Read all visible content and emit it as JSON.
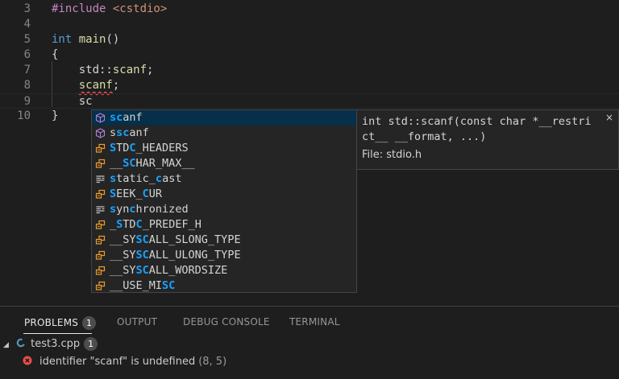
{
  "editor": {
    "lines": [
      {
        "num": "3",
        "segments": [
          {
            "text": "#include ",
            "cls": "tok-inc"
          },
          {
            "text": "<cstdio>",
            "cls": "tok-str"
          }
        ]
      },
      {
        "num": "4",
        "segments": []
      },
      {
        "num": "5",
        "segments": [
          {
            "text": "int",
            "cls": "tok-kw"
          },
          {
            "text": " ",
            "cls": "tok-plain"
          },
          {
            "text": "main",
            "cls": "tok-fn"
          },
          {
            "text": "()",
            "cls": "tok-plain"
          }
        ]
      },
      {
        "num": "6",
        "segments": [
          {
            "text": "{",
            "cls": "tok-plain"
          }
        ]
      },
      {
        "num": "7",
        "segments": [
          {
            "text": "    std::",
            "cls": "tok-plain"
          },
          {
            "text": "scanf",
            "cls": "tok-fn"
          },
          {
            "text": ";",
            "cls": "tok-plain"
          }
        ]
      },
      {
        "num": "8",
        "segments": [
          {
            "text": "    ",
            "cls": "tok-plain"
          },
          {
            "text": "scanf",
            "cls": "tok-fn squiggle"
          },
          {
            "text": ";",
            "cls": "tok-plain"
          }
        ]
      },
      {
        "num": "9",
        "segments": [
          {
            "text": "    sc",
            "cls": "tok-plain"
          }
        ]
      },
      {
        "num": "10",
        "segments": [
          {
            "text": "}",
            "cls": "tok-plain"
          }
        ]
      }
    ]
  },
  "suggest": {
    "items": [
      {
        "kind": "cube",
        "parts": [
          {
            "t": "sc",
            "h": true
          },
          {
            "t": "anf",
            "h": false
          }
        ]
      },
      {
        "kind": "cube",
        "parts": [
          {
            "t": "s",
            "h": false
          },
          {
            "t": "sc",
            "h": true
          },
          {
            "t": "anf",
            "h": false
          }
        ]
      },
      {
        "kind": "enum",
        "parts": [
          {
            "t": "S",
            "h": true
          },
          {
            "t": "TD",
            "h": false
          },
          {
            "t": "C",
            "h": true
          },
          {
            "t": "_HEADERS",
            "h": false
          }
        ]
      },
      {
        "kind": "enum",
        "parts": [
          {
            "t": "__",
            "h": false
          },
          {
            "t": "SC",
            "h": true
          },
          {
            "t": "HAR_MAX__",
            "h": false
          }
        ]
      },
      {
        "kind": "kw",
        "parts": [
          {
            "t": "s",
            "h": true
          },
          {
            "t": "tatic_",
            "h": false
          },
          {
            "t": "c",
            "h": true
          },
          {
            "t": "ast",
            "h": false
          }
        ]
      },
      {
        "kind": "enum",
        "parts": [
          {
            "t": "S",
            "h": true
          },
          {
            "t": "EEK_",
            "h": false
          },
          {
            "t": "C",
            "h": true
          },
          {
            "t": "UR",
            "h": false
          }
        ]
      },
      {
        "kind": "kw",
        "parts": [
          {
            "t": "s",
            "h": true
          },
          {
            "t": "yn",
            "h": false
          },
          {
            "t": "c",
            "h": true
          },
          {
            "t": "hronized",
            "h": false
          }
        ]
      },
      {
        "kind": "enum",
        "parts": [
          {
            "t": "_",
            "h": false
          },
          {
            "t": "S",
            "h": true
          },
          {
            "t": "TD",
            "h": false
          },
          {
            "t": "C",
            "h": true
          },
          {
            "t": "_PREDEF_H",
            "h": false
          }
        ]
      },
      {
        "kind": "enum",
        "parts": [
          {
            "t": "__SY",
            "h": false
          },
          {
            "t": "SC",
            "h": true
          },
          {
            "t": "ALL_SLONG_TYPE",
            "h": false
          }
        ]
      },
      {
        "kind": "enum",
        "parts": [
          {
            "t": "__SY",
            "h": false
          },
          {
            "t": "SC",
            "h": true
          },
          {
            "t": "ALL_ULONG_TYPE",
            "h": false
          }
        ]
      },
      {
        "kind": "enum",
        "parts": [
          {
            "t": "__SY",
            "h": false
          },
          {
            "t": "SC",
            "h": true
          },
          {
            "t": "ALL_WORDSIZE",
            "h": false
          }
        ]
      },
      {
        "kind": "enum",
        "parts": [
          {
            "t": "__USE_MI",
            "h": false
          },
          {
            "t": "SC",
            "h": true
          }
        ]
      }
    ],
    "selected_index": 0,
    "highlight_color": "#18a3ff"
  },
  "details": {
    "signature": "int std::scanf(const char *__restrict__ __format, ...)",
    "file": "File: stdio.h",
    "close_glyph": "×"
  },
  "panel": {
    "tabs": [
      {
        "label": "PROBLEMS",
        "badge": "1",
        "active": true
      },
      {
        "label": "OUTPUT",
        "active": false
      },
      {
        "label": "DEBUG CONSOLE",
        "active": false
      },
      {
        "label": "TERMINAL",
        "active": false
      }
    ],
    "file_row": {
      "name": "test3.cpp",
      "count": "1"
    },
    "problem": {
      "message": "identifier \"scanf\" is undefined",
      "location": "(8, 5)"
    }
  }
}
